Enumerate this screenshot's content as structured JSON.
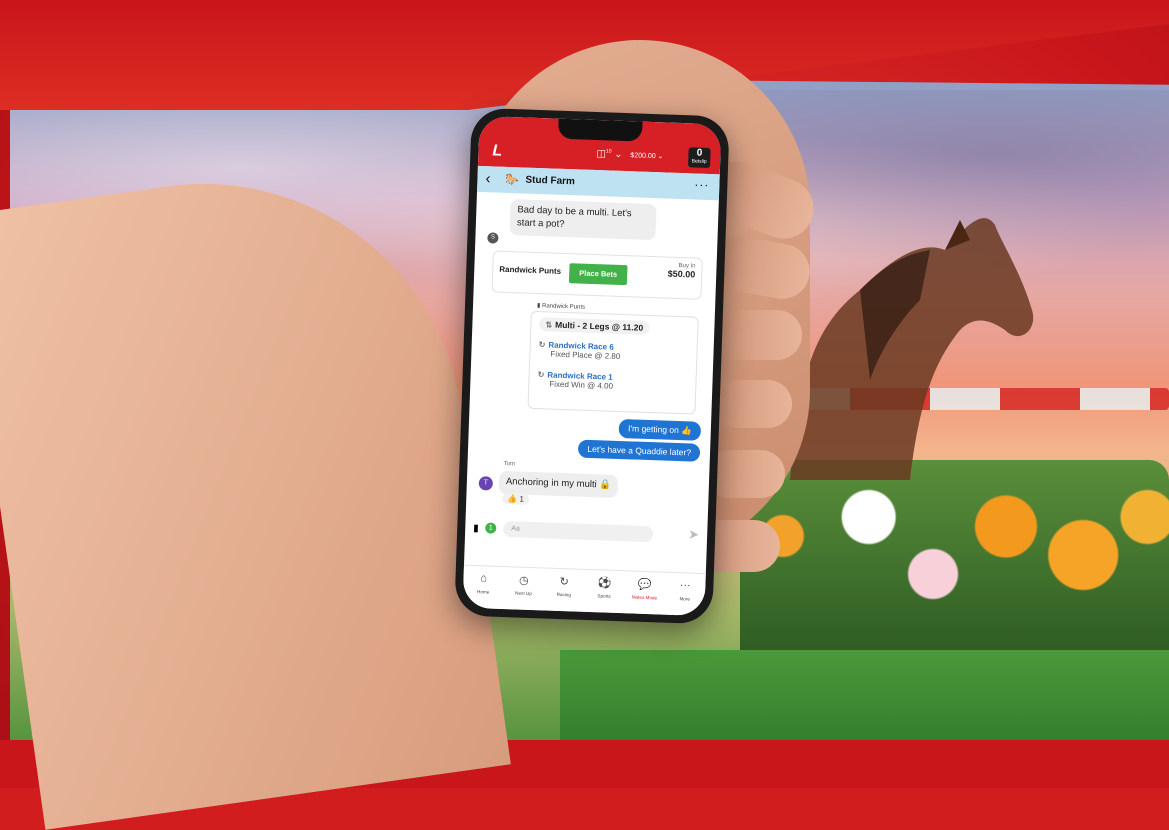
{
  "app": {
    "logo": "L",
    "wallet_icon": "wallet-icon",
    "wallet_count": "10",
    "balance": "$200.00",
    "betslip_count": "0",
    "betslip_label": "Betslip"
  },
  "chat": {
    "group_name": "Stud Farm",
    "group_icon": "horse-icon",
    "messages": {
      "m1": "Bad day to be a multi. Let's start a pot?",
      "m1_avatar": "S",
      "pot": {
        "name": "Randwick Punts",
        "button": "Place Bets",
        "buyin_label": "Buy In",
        "buyin_value": "$50.00"
      },
      "bet_label": "Randwick Punts",
      "bet": {
        "multi": "Multi - 2 Legs @ 11.20",
        "legs": [
          {
            "race": "Randwick Race 6",
            "odds": "Fixed Place @ 2.80"
          },
          {
            "race": "Randwick Race 1",
            "odds": "Fixed Win @ 4.00"
          }
        ]
      },
      "r1": "I'm getting on 👍",
      "r2": "Let's have a Quaddie later?",
      "sender": "Tom",
      "sender_avatar": "T",
      "m2": "Anchoring in my multi 🔒",
      "reaction": "👍 1"
    },
    "composer": {
      "badge": "1",
      "placeholder": "Aa"
    }
  },
  "tabs": [
    {
      "label": "Home",
      "icon": "home-icon"
    },
    {
      "label": "Next Up",
      "icon": "clock-icon"
    },
    {
      "label": "Racing",
      "icon": "racing-icon"
    },
    {
      "label": "Sports",
      "icon": "sports-icon"
    },
    {
      "label": "Mates Mode",
      "icon": "chat-icon",
      "active": true
    },
    {
      "label": "More",
      "icon": "more-icon"
    }
  ],
  "colors": {
    "brand_red": "#d71f26",
    "chat_blue": "#1f74d4",
    "place_green": "#43b14a",
    "chat_header": "#bfe2f3"
  }
}
